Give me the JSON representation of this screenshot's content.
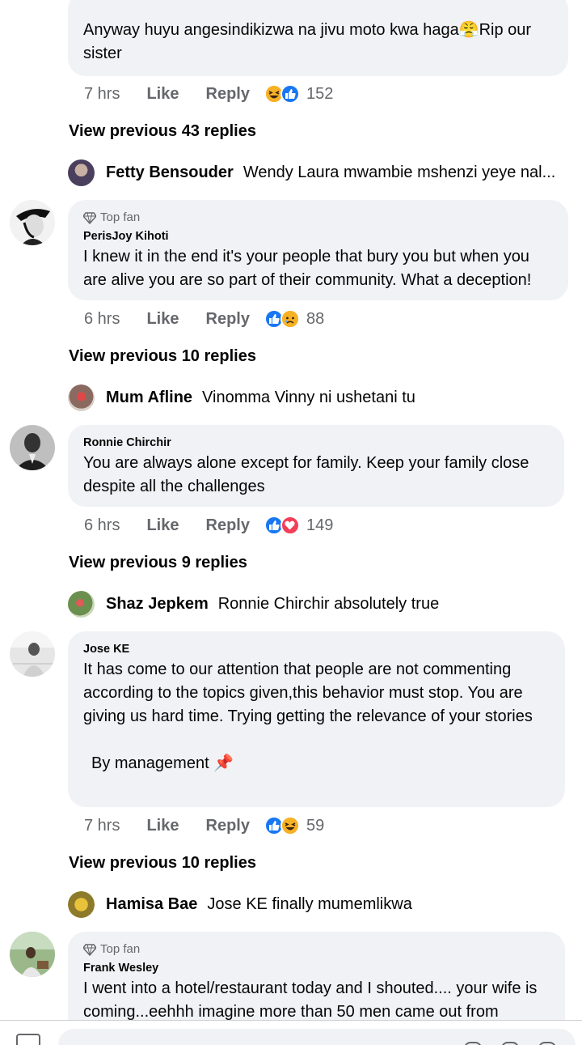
{
  "colors": {
    "bubble": "#f0f2f5",
    "secondary": "#65676b",
    "like_blue": "#1877f2",
    "love_red": "#f33e58",
    "haha_yellow": "#f7b125"
  },
  "comments": [
    {
      "text": "Anyway huyu angesindikizwa na jivu moto kwa haga😤Rip our sister",
      "time": "7 hrs",
      "like": "Like",
      "reply": "Reply",
      "reactions": [
        "haha",
        "like"
      ],
      "reaction_count": "152",
      "view_previous": "View previous 43 replies",
      "latest_reply": {
        "name": "Fetty Bensouder",
        "text": "Wendy Laura mwambie mshenzi yeye nal..."
      }
    },
    {
      "badge": "Top fan",
      "author": "PerisJoy Kihoti",
      "text": "I knew it in the end it's your people that bury you but when you are alive you are so part of their community. What a deception!",
      "time": "6 hrs",
      "like": "Like",
      "reply": "Reply",
      "reactions": [
        "like",
        "sad"
      ],
      "reaction_count": "88",
      "view_previous": "View previous 10 replies",
      "latest_reply": {
        "name": "Mum Afline",
        "text": "Vinomma Vinny ni ushetani tu"
      }
    },
    {
      "author": "Ronnie Chirchir",
      "text": "You are always alone except for family. Keep your family close despite all the challenges",
      "time": "6 hrs",
      "like": "Like",
      "reply": "Reply",
      "reactions": [
        "like",
        "love"
      ],
      "reaction_count": "149",
      "view_previous": "View previous 9 replies",
      "latest_reply": {
        "name": "Shaz Jepkem",
        "text": "Ronnie Chirchir absolutely true"
      }
    },
    {
      "author": "Jose KE",
      "text": "It has come to our attention that people are not commenting according to the topics given,this behavior must stop. You are giving us hard time. Trying getting the relevance of your stories",
      "signature": "By management 📌",
      "time": "7 hrs",
      "like": "Like",
      "reply": "Reply",
      "reactions": [
        "like",
        "haha"
      ],
      "reaction_count": "59",
      "view_previous": "View previous 10 replies",
      "latest_reply": {
        "name": "Hamisa Bae",
        "text": "Jose KE finally mumemlikwa"
      }
    },
    {
      "badge": "Top fan",
      "author": "Frank Wesley",
      "text": "I went into a hotel/restaurant today and I shouted.... your wife is coming...eehhh imagine more than 50 men came out from"
    }
  ]
}
